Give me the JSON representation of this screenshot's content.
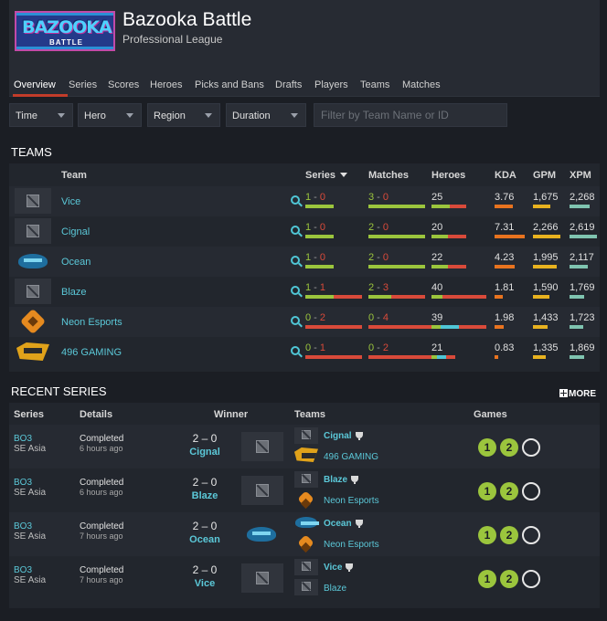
{
  "header": {
    "logo_text": "BAZOOKA",
    "logo_sub": "BATTLE",
    "title": "Bazooka Battle",
    "subtitle": "Professional League"
  },
  "nav": {
    "tabs": [
      "Overview",
      "Series",
      "Scores",
      "Heroes",
      "Picks and Bans",
      "Drafts",
      "Players",
      "Teams",
      "Matches"
    ],
    "active": "Overview"
  },
  "filters": {
    "time": "Time",
    "hero": "Hero",
    "region": "Region",
    "duration": "Duration",
    "search_placeholder": "Filter by Team Name or ID"
  },
  "teams": {
    "title": "TEAMS",
    "headers": {
      "team": "Team",
      "series": "Series",
      "matches": "Matches",
      "heroes": "Heroes",
      "kda": "KDA",
      "gpm": "GPM",
      "xpm": "XPM"
    },
    "rows": [
      {
        "name": "Vice",
        "series_w": "1",
        "series_l": "0",
        "matches_w": "3",
        "matches_l": "0",
        "heroes": "25",
        "kda": "3.76",
        "gpm": "1,675",
        "xpm": "2,268"
      },
      {
        "name": "Cignal",
        "series_w": "1",
        "series_l": "0",
        "matches_w": "2",
        "matches_l": "0",
        "heroes": "20",
        "kda": "7.31",
        "gpm": "2,266",
        "xpm": "2,619"
      },
      {
        "name": "Ocean",
        "series_w": "1",
        "series_l": "0",
        "matches_w": "2",
        "matches_l": "0",
        "heroes": "22",
        "kda": "4.23",
        "gpm": "1,995",
        "xpm": "2,117"
      },
      {
        "name": "Blaze",
        "series_w": "1",
        "series_l": "1",
        "matches_w": "2",
        "matches_l": "3",
        "heroes": "40",
        "kda": "1.81",
        "gpm": "1,590",
        "xpm": "1,769"
      },
      {
        "name": "Neon Esports",
        "series_w": "0",
        "series_l": "2",
        "matches_w": "0",
        "matches_l": "4",
        "heroes": "39",
        "kda": "1.98",
        "gpm": "1,433",
        "xpm": "1,723"
      },
      {
        "name": "496 GAMING",
        "series_w": "0",
        "series_l": "1",
        "matches_w": "0",
        "matches_l": "2",
        "heroes": "21",
        "kda": "0.83",
        "gpm": "1,335",
        "xpm": "1,869"
      }
    ],
    "colors": {
      "win": "#9bc53d",
      "loss": "#d94a3a",
      "heroes_hi": "#4fc6d6",
      "kda": "#e8731f",
      "gpm": "#e8b21f",
      "xpm": "#7fc4b0"
    }
  },
  "recent": {
    "title": "RECENT SERIES",
    "more_label": "MORE",
    "headers": {
      "series": "Series",
      "details": "Details",
      "winner": "Winner",
      "teams": "Teams",
      "games": "Games"
    },
    "rows": [
      {
        "format": "BO3",
        "region": "SE Asia",
        "status": "Completed",
        "ago": "6 hours ago",
        "score": "2 – 0",
        "winner": "Cignal",
        "team_a": "Cignal",
        "team_b": "496 GAMING",
        "game1": "1",
        "game2": "2"
      },
      {
        "format": "BO3",
        "region": "SE Asia",
        "status": "Completed",
        "ago": "6 hours ago",
        "score": "2 – 0",
        "winner": "Blaze",
        "team_a": "Blaze",
        "team_b": "Neon Esports",
        "game1": "1",
        "game2": "2"
      },
      {
        "format": "BO3",
        "region": "SE Asia",
        "status": "Completed",
        "ago": "7 hours ago",
        "score": "2 – 0",
        "winner": "Ocean",
        "team_a": "Ocean",
        "team_b": "Neon Esports",
        "game1": "1",
        "game2": "2"
      },
      {
        "format": "BO3",
        "region": "SE Asia",
        "status": "Completed",
        "ago": "7 hours ago",
        "score": "2 – 0",
        "winner": "Vice",
        "team_a": "Vice",
        "team_b": "Blaze",
        "game1": "1",
        "game2": "2"
      }
    ]
  }
}
